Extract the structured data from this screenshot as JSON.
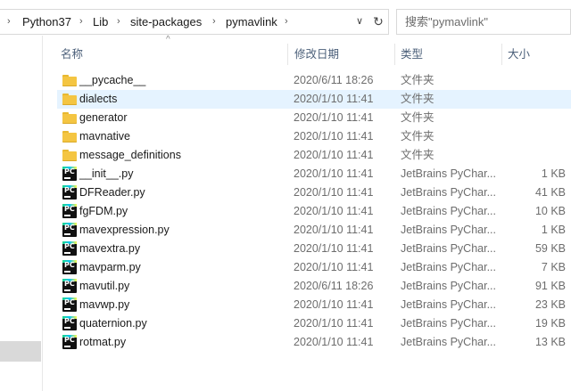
{
  "address_bar": {
    "crumbs": [
      "Python37",
      "Lib",
      "site-packages",
      "pymavlink"
    ],
    "separator": "›",
    "dropdown_glyph": "∨",
    "refresh_glyph": "↻"
  },
  "search": {
    "placeholder": "搜索\"pymavlink\""
  },
  "columns": {
    "name": "名称",
    "date": "修改日期",
    "type": "类型",
    "size": "大小",
    "sort_glyph": "^"
  },
  "files": [
    {
      "name": "__pycache__",
      "date": "2020/6/11 18:26",
      "type": "文件夹",
      "size": "",
      "icon": "folder-icon"
    },
    {
      "name": "dialects",
      "date": "2020/1/10 11:41",
      "type": "文件夹",
      "size": "",
      "icon": "folder-icon",
      "highlighted": true
    },
    {
      "name": "generator",
      "date": "2020/1/10 11:41",
      "type": "文件夹",
      "size": "",
      "icon": "folder-icon"
    },
    {
      "name": "mavnative",
      "date": "2020/1/10 11:41",
      "type": "文件夹",
      "size": "",
      "icon": "folder-icon"
    },
    {
      "name": "message_definitions",
      "date": "2020/1/10 11:41",
      "type": "文件夹",
      "size": "",
      "icon": "folder-icon"
    },
    {
      "name": "__init__.py",
      "date": "2020/1/10 11:41",
      "type": "JetBrains PyChar...",
      "size": "1 KB",
      "icon": "pycharm-file-icon"
    },
    {
      "name": "DFReader.py",
      "date": "2020/1/10 11:41",
      "type": "JetBrains PyChar...",
      "size": "41 KB",
      "icon": "pycharm-file-icon"
    },
    {
      "name": "fgFDM.py",
      "date": "2020/1/10 11:41",
      "type": "JetBrains PyChar...",
      "size": "10 KB",
      "icon": "pycharm-file-icon"
    },
    {
      "name": "mavexpression.py",
      "date": "2020/1/10 11:41",
      "type": "JetBrains PyChar...",
      "size": "1 KB",
      "icon": "pycharm-file-icon"
    },
    {
      "name": "mavextra.py",
      "date": "2020/1/10 11:41",
      "type": "JetBrains PyChar...",
      "size": "59 KB",
      "icon": "pycharm-file-icon"
    },
    {
      "name": "mavparm.py",
      "date": "2020/1/10 11:41",
      "type": "JetBrains PyChar...",
      "size": "7 KB",
      "icon": "pycharm-file-icon"
    },
    {
      "name": "mavutil.py",
      "date": "2020/6/11 18:26",
      "type": "JetBrains PyChar...",
      "size": "91 KB",
      "icon": "pycharm-file-icon"
    },
    {
      "name": "mavwp.py",
      "date": "2020/1/10 11:41",
      "type": "JetBrains PyChar...",
      "size": "23 KB",
      "icon": "pycharm-file-icon"
    },
    {
      "name": "quaternion.py",
      "date": "2020/1/10 11:41",
      "type": "JetBrains PyChar...",
      "size": "19 KB",
      "icon": "pycharm-file-icon"
    },
    {
      "name": "rotmat.py",
      "date": "2020/1/10 11:41",
      "type": "JetBrains PyChar...",
      "size": "13 KB",
      "icon": "pycharm-file-icon"
    }
  ],
  "colors": {
    "highlight_row": "#e5f3ff",
    "header_text": "#4c607a",
    "folder": "#f4c542"
  }
}
